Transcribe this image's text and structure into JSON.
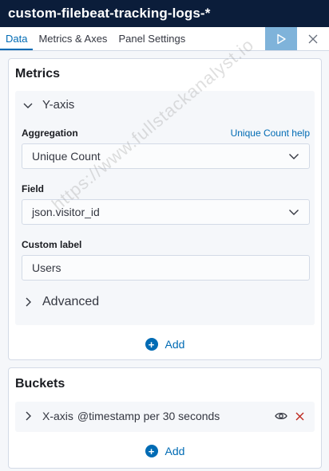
{
  "header": {
    "title": "custom-filebeat-tracking-logs-*"
  },
  "tabs": [
    {
      "label": "Data",
      "active": true
    },
    {
      "label": "Metrics & Axes",
      "active": false
    },
    {
      "label": "Panel Settings",
      "active": false
    }
  ],
  "actions": {
    "apply_icon": "play-icon",
    "discard_icon": "close-icon"
  },
  "metrics": {
    "title": "Metrics",
    "y_axis": {
      "title": "Y-axis",
      "aggregation_label": "Aggregation",
      "aggregation_help": "Unique Count help",
      "aggregation_value": "Unique Count",
      "field_label": "Field",
      "field_value": "json.visitor_id",
      "custom_label_label": "Custom label",
      "custom_label_value": "Users",
      "advanced_label": "Advanced"
    },
    "add_label": "Add"
  },
  "buckets": {
    "title": "Buckets",
    "x_axis": {
      "title": "X-axis",
      "description": "@timestamp per 30 seconds"
    },
    "add_label": "Add"
  },
  "watermark": "https://www.fullstackanalyst.io",
  "colors": {
    "header_bg": "#0b1d3a",
    "accent": "#006bb4",
    "apply_bg": "#7fb3da",
    "danger": "#bd271e"
  }
}
